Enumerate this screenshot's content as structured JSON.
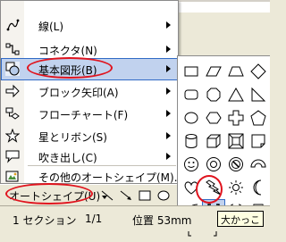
{
  "menu": {
    "items": [
      {
        "label": "線(L)",
        "icon": "lines-icon",
        "submenu": true
      },
      {
        "label": "コネクタ(N)",
        "icon": "connector-icon",
        "submenu": true
      },
      {
        "label": "基本図形(B)",
        "icon": "basic-shapes-icon",
        "submenu": true,
        "highlighted": true
      },
      {
        "label": "ブロック矢印(A)",
        "icon": "block-arrows-icon",
        "submenu": true
      },
      {
        "label": "フローチャート(F)",
        "icon": "flowchart-icon",
        "submenu": true
      },
      {
        "label": "星とリボン(S)",
        "icon": "stars-ribbons-icon",
        "submenu": true
      },
      {
        "label": "吹き出し(C)",
        "icon": "callout-icon",
        "submenu": true
      },
      {
        "label": "その他のオートシェイプ(M)...",
        "icon": "more-autoshapes-icon",
        "submenu": false
      }
    ]
  },
  "submenu": {
    "shapes": [
      "rectangle",
      "parallelogram",
      "trapezoid",
      "diamond",
      "rounded-rectangle",
      "octagon",
      "triangle",
      "right-triangle",
      "oval",
      "hexagon",
      "cross",
      "pentagon",
      "can",
      "cube",
      "bevel",
      "folded-corner",
      "smiley-face",
      "donut",
      "no-symbol",
      "block-arc",
      "heart",
      "lightning-bolt",
      "sun",
      "moon",
      "arc",
      "double-bracket",
      "double-brace",
      "plaque",
      "left-bracket",
      "right-bracket",
      "left-brace",
      "right-brace"
    ],
    "selected_index": 25
  },
  "toolbar": {
    "autoshapes_label": "オートシェイプ(U)"
  },
  "statusbar": {
    "section": "1 セクション",
    "page": "1/1",
    "position": "位置 53mm"
  },
  "tooltip": "大かっこ",
  "colors": {
    "highlight": "#c1d2ee",
    "highlight_border": "#316ac5",
    "annotation": "#e0141e",
    "face": "#ece9d8"
  }
}
